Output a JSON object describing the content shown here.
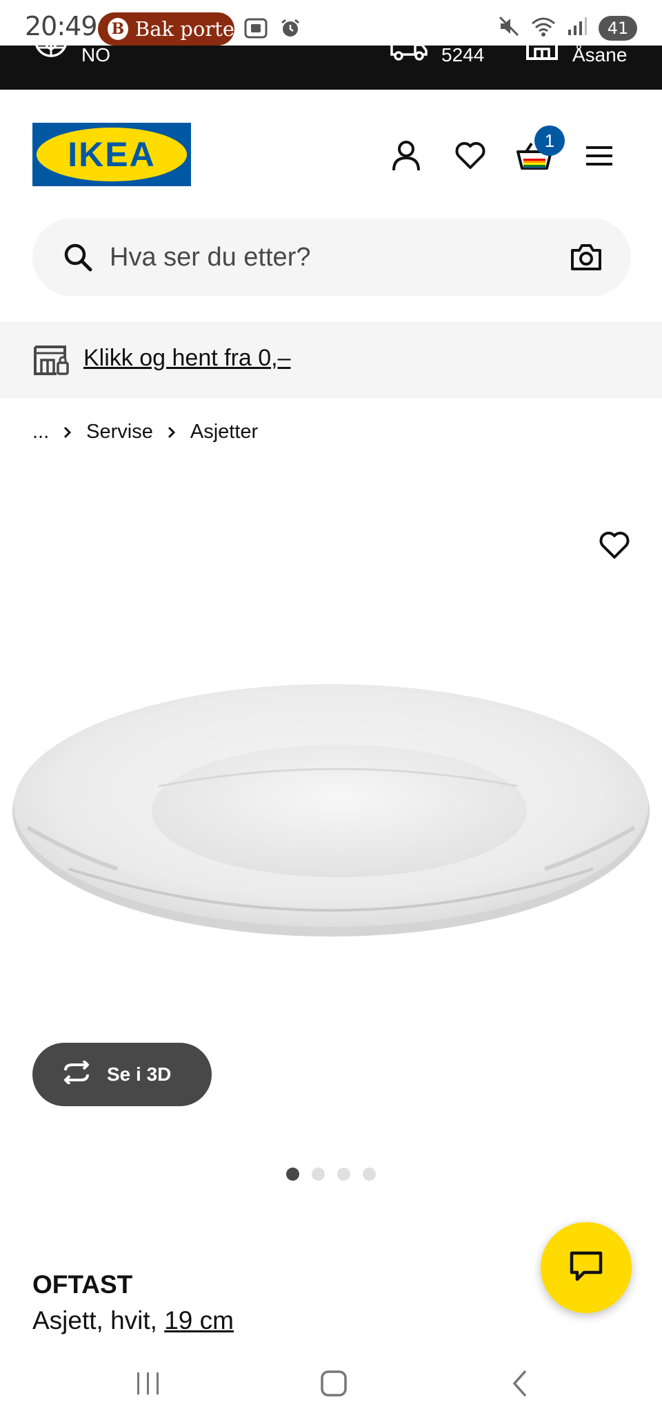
{
  "status_bar": {
    "time": "20:49",
    "notification_logo": "B",
    "notification_text": "Bak porte",
    "battery": "41",
    "icons": [
      "screenshot-icon",
      "alarm-icon",
      "mute-icon",
      "wifi-icon",
      "signal-icon"
    ]
  },
  "top_bar": {
    "language": "NO",
    "postal_code": "5244",
    "store": "Åsane"
  },
  "header": {
    "logo_text": "IKEA",
    "cart_count": "1"
  },
  "search": {
    "placeholder": "Hva ser du etter?"
  },
  "pickup_banner": {
    "link_text": "Klikk og hent fra 0,–"
  },
  "breadcrumb": {
    "items": [
      "...",
      "Servise",
      "Asjetter"
    ]
  },
  "product": {
    "view_3d_label": "Se i 3D",
    "image_count": 4,
    "active_image": 1,
    "name": "OFTAST",
    "description": "Asjett, hvit, ",
    "size": "19 cm"
  },
  "colors": {
    "ikea_blue": "#0058a3",
    "ikea_yellow": "#ffdb00",
    "dark_grey": "#484848",
    "light_grey": "#f5f5f5"
  }
}
